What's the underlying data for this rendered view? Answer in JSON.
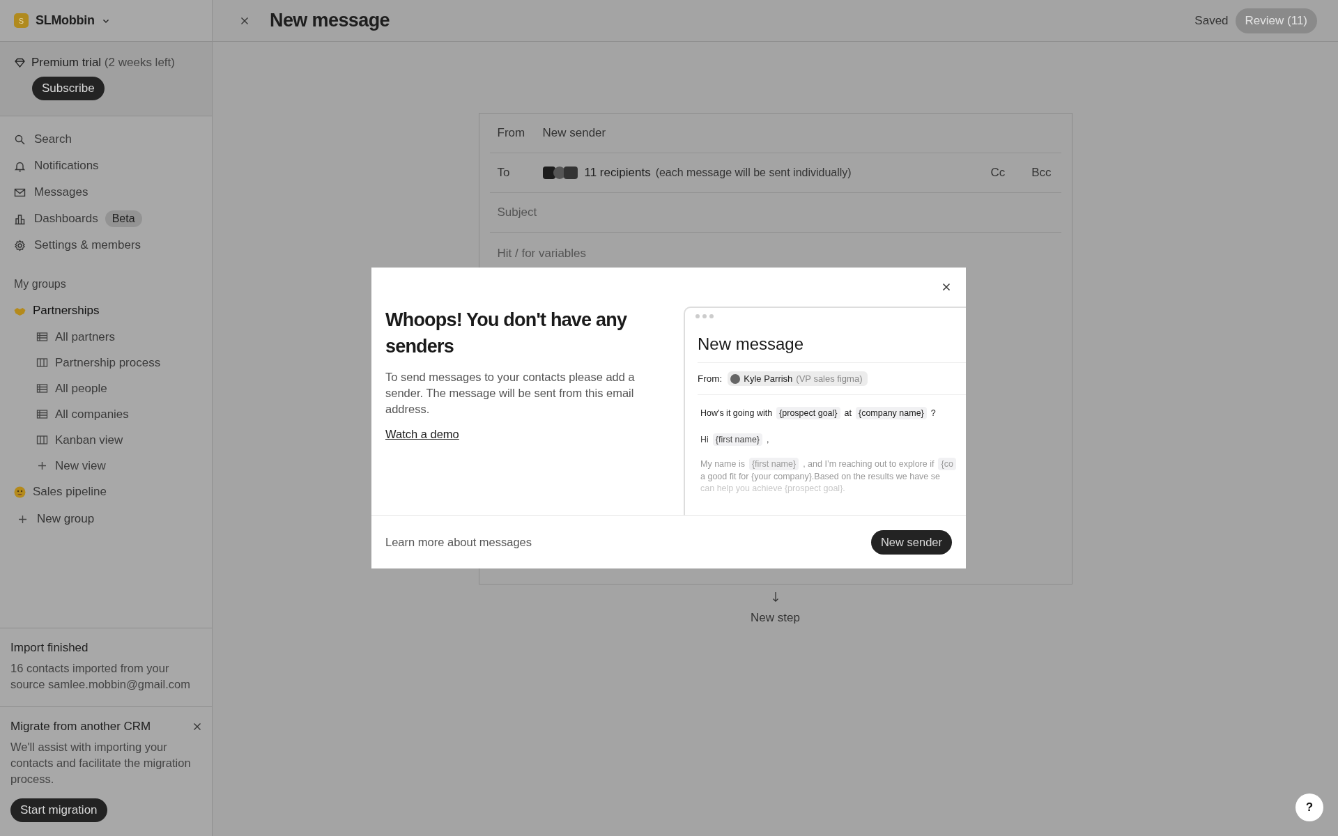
{
  "workspace": {
    "initial": "S",
    "name": "SLMobbin"
  },
  "trial": {
    "label": "Premium trial",
    "note": "(2 weeks left)",
    "button": "Subscribe"
  },
  "nav": [
    {
      "kind": "search",
      "label": "Search"
    },
    {
      "kind": "bell",
      "label": "Notifications"
    },
    {
      "kind": "mail",
      "label": "Messages"
    },
    {
      "kind": "chart",
      "label": "Dashboards",
      "badge": "Beta"
    },
    {
      "kind": "gear",
      "label": "Settings & members"
    }
  ],
  "groups": {
    "heading": "My groups",
    "items": [
      {
        "kind": "handshake",
        "label": "Partnerships",
        "selected": true,
        "children": [
          {
            "kind": "table",
            "label": "All partners"
          },
          {
            "kind": "columns",
            "label": "Partnership process"
          },
          {
            "kind": "table",
            "label": "All people"
          },
          {
            "kind": "table",
            "label": "All companies"
          },
          {
            "kind": "columns",
            "label": "Kanban view"
          },
          {
            "kind": "plus",
            "label": "New view"
          }
        ]
      },
      {
        "kind": "face",
        "label": "Sales pipeline",
        "selected": false
      }
    ],
    "new_group": "New group"
  },
  "import_notice": {
    "title": "Import finished",
    "text": "16 contacts imported from your source samlee.mobbin@gmail.com"
  },
  "migrate_notice": {
    "title": "Migrate from another CRM",
    "text": "We'll assist with importing your contacts and facilitate the migration process.",
    "button": "Start migration"
  },
  "topbar": {
    "title": "New message",
    "saved": "Saved",
    "review": "Review",
    "review_count": "(11)",
    "review_disabled": true
  },
  "compose": {
    "from_label": "From",
    "from_value": "New sender",
    "to_label": "To",
    "recipients": "11 recipients",
    "recipients_note": "(each message will be sent individually)",
    "cc": "Cc",
    "bcc": "Bcc",
    "subject_placeholder": "Subject",
    "body_placeholder": "Hit / for variables"
  },
  "new_step": "New step",
  "modal": {
    "title": "Whoops! You don't have any senders",
    "text": "To send messages to your contacts please add a sender. The message will be sent from this email address.",
    "link": "Watch a demo",
    "preview": {
      "title": "New message",
      "from_label": "From:",
      "sender": "Kyle Parrish",
      "sender_role": "(VP sales figma)",
      "lines": [
        {
          "kind": "subject",
          "parts": [
            {
              "kind": "text",
              "text": "How's it going with"
            },
            {
              "kind": "var",
              "text": "{prospect goal}"
            },
            {
              "kind": "text",
              "text": "at"
            },
            {
              "kind": "var",
              "text": "{company name}"
            },
            {
              "kind": "text",
              "text": "?"
            }
          ]
        },
        {
          "kind": "greeting",
          "parts": [
            {
              "kind": "text",
              "text": "Hi"
            },
            {
              "kind": "var",
              "text": "{first name}"
            },
            {
              "kind": "text",
              "text": ","
            }
          ]
        },
        {
          "kind": "body",
          "parts": [
            {
              "kind": "text",
              "text": "My name is"
            },
            {
              "kind": "var",
              "text": "{first name}"
            },
            {
              "kind": "text",
              "text": ", and I’m reaching out to explore if"
            },
            {
              "kind": "var",
              "text": "{co"
            }
          ]
        },
        {
          "kind": "body",
          "parts": [
            {
              "kind": "text",
              "text": "a good fit for {your company}.Based on the results we have se"
            }
          ]
        },
        {
          "kind": "faded",
          "parts": [
            {
              "kind": "text",
              "text": "can help you achieve {prospect goal}."
            }
          ]
        }
      ]
    },
    "footer_link": "Learn more about messages",
    "button": "New sender"
  },
  "help": "?"
}
